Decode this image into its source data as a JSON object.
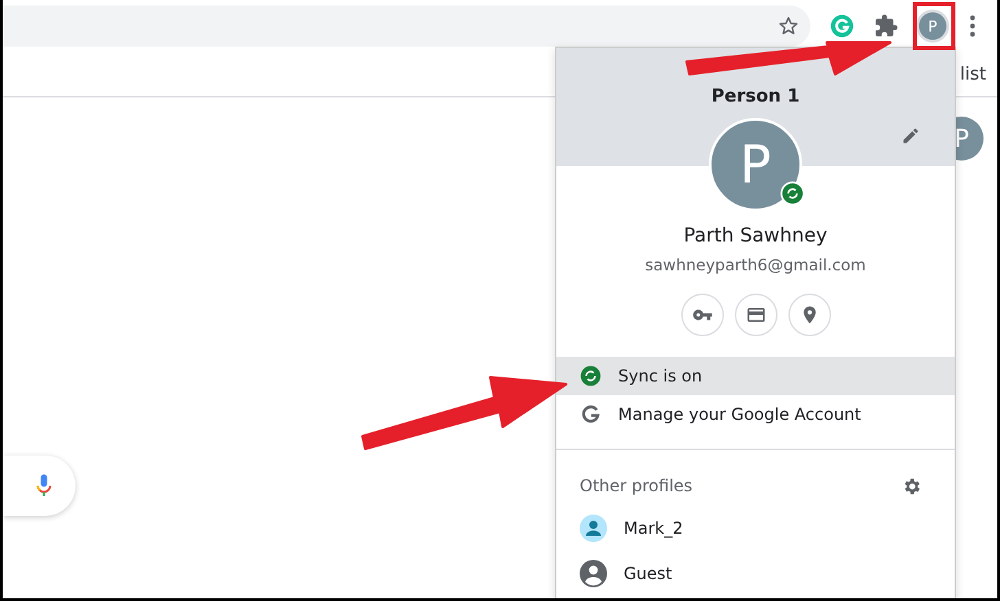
{
  "toolbar": {
    "avatar_letter": "P"
  },
  "bookmarks_bar": {
    "text": "list"
  },
  "page": {
    "avatar_letter": "P"
  },
  "profile_menu": {
    "title": "Person 1",
    "avatar_letter": "P",
    "name": "Parth Sawhney",
    "email": "sawhneyparth6@gmail.com",
    "items": [
      {
        "kind": "sync",
        "label": "Sync is on",
        "selected": true
      },
      {
        "kind": "google",
        "label": "Manage your Google Account",
        "selected": false
      }
    ],
    "other_profiles": {
      "heading": "Other profiles",
      "profiles": [
        {
          "kind": "person",
          "name": "Mark_2"
        },
        {
          "kind": "guest",
          "name": "Guest"
        }
      ]
    }
  }
}
